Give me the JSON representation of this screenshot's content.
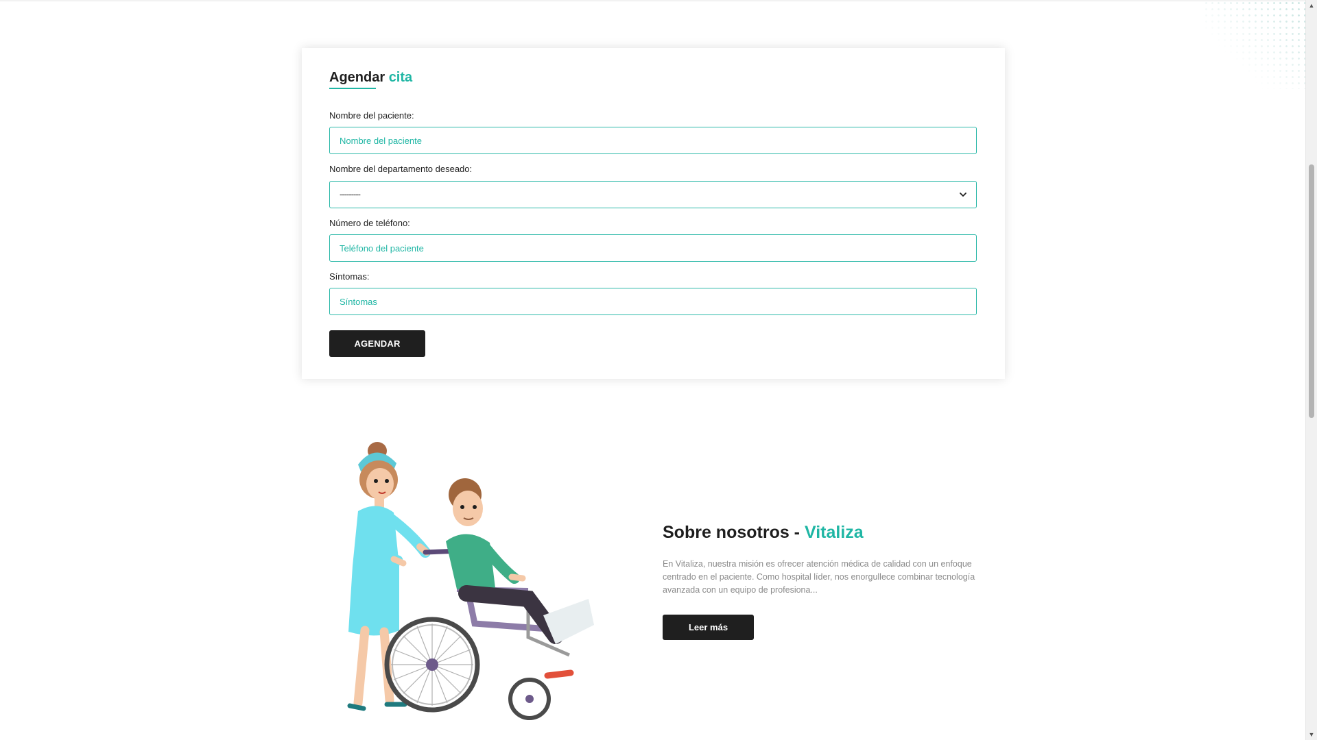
{
  "form": {
    "title_main": "Agendar",
    "title_accent": "cita",
    "patient_label": "Nombre del paciente:",
    "patient_placeholder": "Nombre del paciente",
    "department_label": "Nombre del departamento deseado:",
    "department_value": "---------",
    "phone_label": "Número de teléfono:",
    "phone_placeholder": "Teléfono del paciente",
    "symptoms_label": "Síntomas:",
    "symptoms_placeholder": "Síntomas",
    "submit_label": "AGENDAR"
  },
  "about": {
    "title_main": "Sobre nosotros - ",
    "title_accent": "Vitaliza",
    "text": "En Vitaliza, nuestra misión es ofrecer atención médica de calidad con un enfoque centrado en el paciente. Como hospital líder, nos enorgullece combinar tecnología avanzada con un equipo de profesiona...",
    "button_label": "Leer más",
    "illustration": "nurse-pushing-wheelchair-patient"
  },
  "colors": {
    "accent": "#1fb6a4",
    "dark_button": "#1f1f1f"
  }
}
